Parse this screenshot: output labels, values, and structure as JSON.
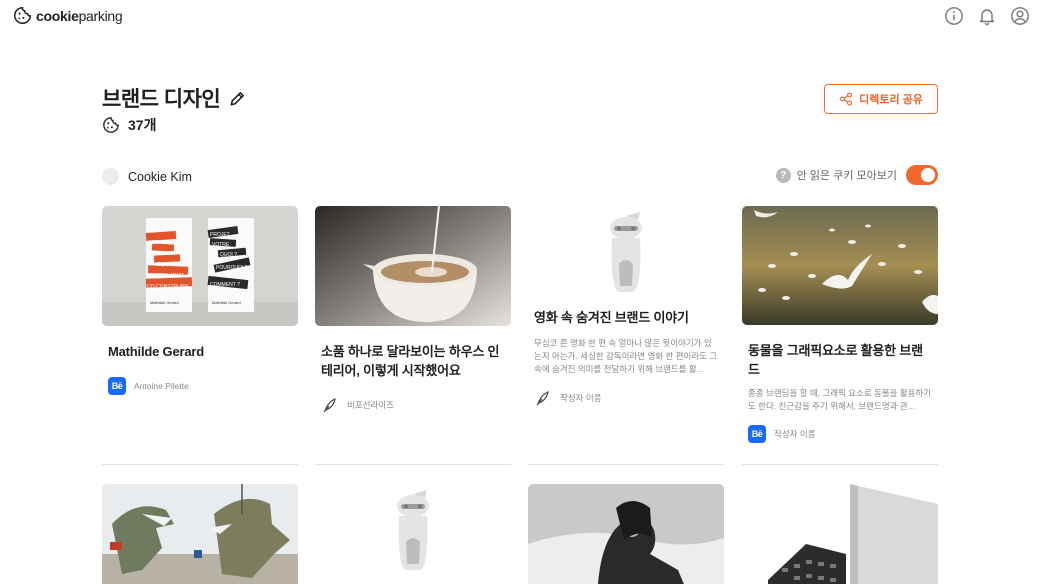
{
  "app": {
    "logo_bold": "cookie",
    "logo_light": "parking"
  },
  "header": {
    "title": "브랜드 디자인",
    "count": "37개",
    "share_label": "디렉토리 공유",
    "owner_name": "Cookie Kim",
    "unread_label": "안 읽은 쿠키 모아보기",
    "unread_toggle_on": true
  },
  "colors": {
    "accent": "#f06a2e",
    "behance": "#1769ff"
  },
  "cards": [
    {
      "title": "Mathilde Gerard",
      "author": "Antoine Pilette",
      "author_icon": "behance-icon",
      "thumb_text_left": [
        "GESTION",
        "PROJET",
        "EQUIPE",
        "PARTENARIAT",
        "CO-CONSTRUIRE"
      ],
      "thumb_text_right": [
        "PROJET",
        "VOTRE",
        "QUOI ?",
        "POURQUOI ?",
        "COMMENT ?"
      ],
      "thumb_caption": "Mathilde Gerard"
    },
    {
      "title": "소품 하나로 달라보이는 하우스 인테리어, 이렇게 시작했어요",
      "author": "비포선라이즈",
      "author_icon": "feather-icon"
    },
    {
      "title": "영화 속 숨겨진 브랜드 이야기",
      "description": "무심코 픈 영화 한 편 속 얼마나 많은 뒷이야기가 있는지 아는가. 세심한 감독이라면 영화 한 편이라도 그 속에 숨겨진 의미를 전달하기 위해 브랜드를 활...",
      "author": "작성자 이름",
      "author_icon": "feather-icon"
    },
    {
      "title": "동물을 그래픽요소로 활용한 브랜드",
      "description": "종종 브랜딩을 할 때, 그래픽 요소로 동물을 활용하기도 한다. 친근감을 주기 위해서, 브랜드명과 관...",
      "author": "작성자 이름",
      "author_icon": "behance-icon"
    }
  ]
}
